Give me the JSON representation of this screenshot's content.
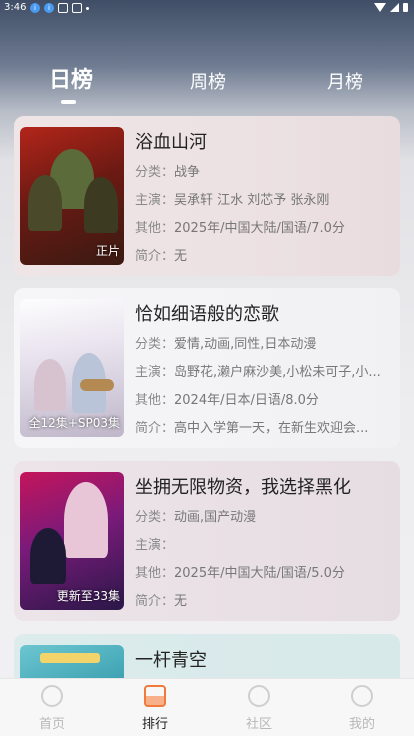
{
  "status_bar": {
    "time": "3:46",
    "dots": [
      "i",
      "i"
    ]
  },
  "tabs": [
    {
      "label": "日榜",
      "active": true
    },
    {
      "label": "周榜",
      "active": false
    },
    {
      "label": "月榜",
      "active": false
    }
  ],
  "cards": [
    {
      "title": "浴血山河",
      "poster_label": "正片",
      "category_label": "分类：",
      "category": "战争",
      "cast_label": "主演：",
      "cast": "吴承轩 江水 刘芯予 张永刚",
      "other_label": "其他：",
      "other": "2025年/中国大陆/国语/7.0分",
      "intro_label": "简介：",
      "intro": "无"
    },
    {
      "title": "恰如细语般的恋歌",
      "poster_label": "全12集+SP03集",
      "category_label": "分类：",
      "category": "爱情,动画,同性,日本动漫",
      "cast_label": "主演：",
      "cast": "岛野花,濑户麻沙美,小松未可子,小...",
      "other_label": "其他：",
      "other": "2024年/日本/日语/8.0分",
      "intro_label": "简介：",
      "intro": "高中入学第一天，在新生欢迎会..."
    },
    {
      "title": "坐拥无限物资，我选择黑化",
      "poster_label": "更新至33集",
      "category_label": "分类：",
      "category": "动画,国产动漫",
      "cast_label": "主演：",
      "cast": "",
      "other_label": "其他：",
      "other": "2025年/中国大陆/国语/5.0分",
      "intro_label": "简介：",
      "intro": "无"
    },
    {
      "title": "一杆青空"
    }
  ],
  "bottom_nav": [
    {
      "label": "首页",
      "icon": "home-icon",
      "active": false
    },
    {
      "label": "排行",
      "icon": "rank-icon",
      "active": true
    },
    {
      "label": "社区",
      "icon": "community-icon",
      "active": false
    },
    {
      "label": "我的",
      "icon": "profile-icon",
      "active": false
    }
  ],
  "colors": {
    "active_accent": "#f07a3c",
    "inactive_nav": "#b8b8b8"
  }
}
